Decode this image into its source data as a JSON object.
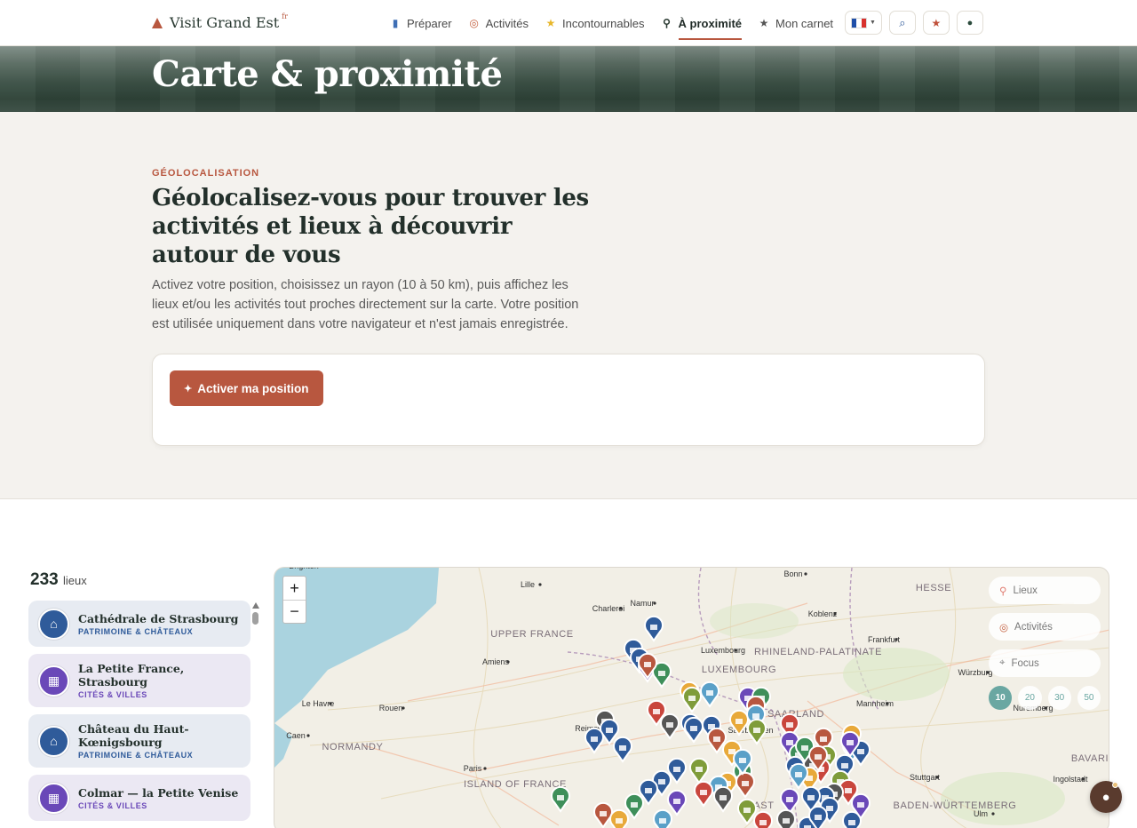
{
  "nav": {
    "brand": "Visit Grand Est",
    "brand_sup": "fr",
    "links": [
      {
        "label": "Préparer",
        "icon": "luggage-icon",
        "glyph": "▮",
        "color": "#3f6fb5"
      },
      {
        "label": "Activités",
        "icon": "target-icon",
        "glyph": "◎",
        "color": "#c4603f"
      },
      {
        "label": "Incontournables",
        "icon": "star-icon",
        "glyph": "★",
        "color": "#e8b72a"
      },
      {
        "label": "À proximité",
        "icon": "pin-icon",
        "glyph": "⚲",
        "color": "#2b3b33",
        "active": true
      },
      {
        "label": "Mon carnet",
        "icon": "star-outline-icon",
        "glyph": "★",
        "color": "#555555"
      }
    ],
    "lang": "FR"
  },
  "hero": {
    "title": "Carte & proximité"
  },
  "intro": {
    "eyebrow": "GÉOLOCALISATION",
    "heading": "Géolocalisez-vous pour trouver les activités et lieux à découvrir autour de vous",
    "text": "Activez votre position, choisissez un rayon (10 à 50 km), puis affichez les lieux et/ou les activités tout proches directement sur la carte. Votre position est utilisée uniquement dans votre navigateur et n'est jamais enregistrée.",
    "button": "Activer ma position"
  },
  "results": {
    "count": "233",
    "unit": "lieux",
    "items": [
      {
        "title": "Cathédrale de Strasbourg",
        "category": "PATRIMOINE & CHÂTEAUX",
        "type": "patri"
      },
      {
        "title": "La Petite France, Strasbourg",
        "category": "CITÉS & VILLES",
        "type": "cites"
      },
      {
        "title": "Château du Haut-Kœnigsbourg",
        "category": "PATRIMOINE & CHÂTEAUX",
        "type": "patri"
      },
      {
        "title": "Colmar — la Petite Venise",
        "category": "CITÉS & VILLES",
        "type": "cites"
      }
    ]
  },
  "map": {
    "zoom_in": "+",
    "zoom_out": "−",
    "toggles": [
      {
        "label": "Lieux",
        "icon": "pin-icon"
      },
      {
        "label": "Activités",
        "icon": "target-icon"
      },
      {
        "label": "Focus",
        "icon": "telescope-icon"
      }
    ],
    "radii": [
      "10",
      "20",
      "30",
      "50"
    ],
    "selected_radius": "10",
    "regions": [
      "UPPER FRANCE",
      "LUXEMBOURG",
      "RHINELAND-PALATINATE",
      "HESSE",
      "NORMANDY",
      "ISLAND OF FRANCE",
      "SAARLAND",
      "BADEN-WÜRTTEMBERG",
      "BAVARIA",
      "EAST"
    ],
    "cities": [
      "Brighton",
      "Lille",
      "Namur",
      "Charleroi",
      "Bonn",
      "Koblenz",
      "Frankfurt",
      "Amiens",
      "Le Havre",
      "Rouen",
      "Caen",
      "Paris",
      "Mannheim",
      "Würzburg",
      "Nuremberg",
      "Stuttgart",
      "Ingolstadt",
      "Ulm",
      "Saarbrücken",
      "Reims",
      "Luxembourg"
    ]
  },
  "chat": {
    "icon": "chat-icon"
  }
}
